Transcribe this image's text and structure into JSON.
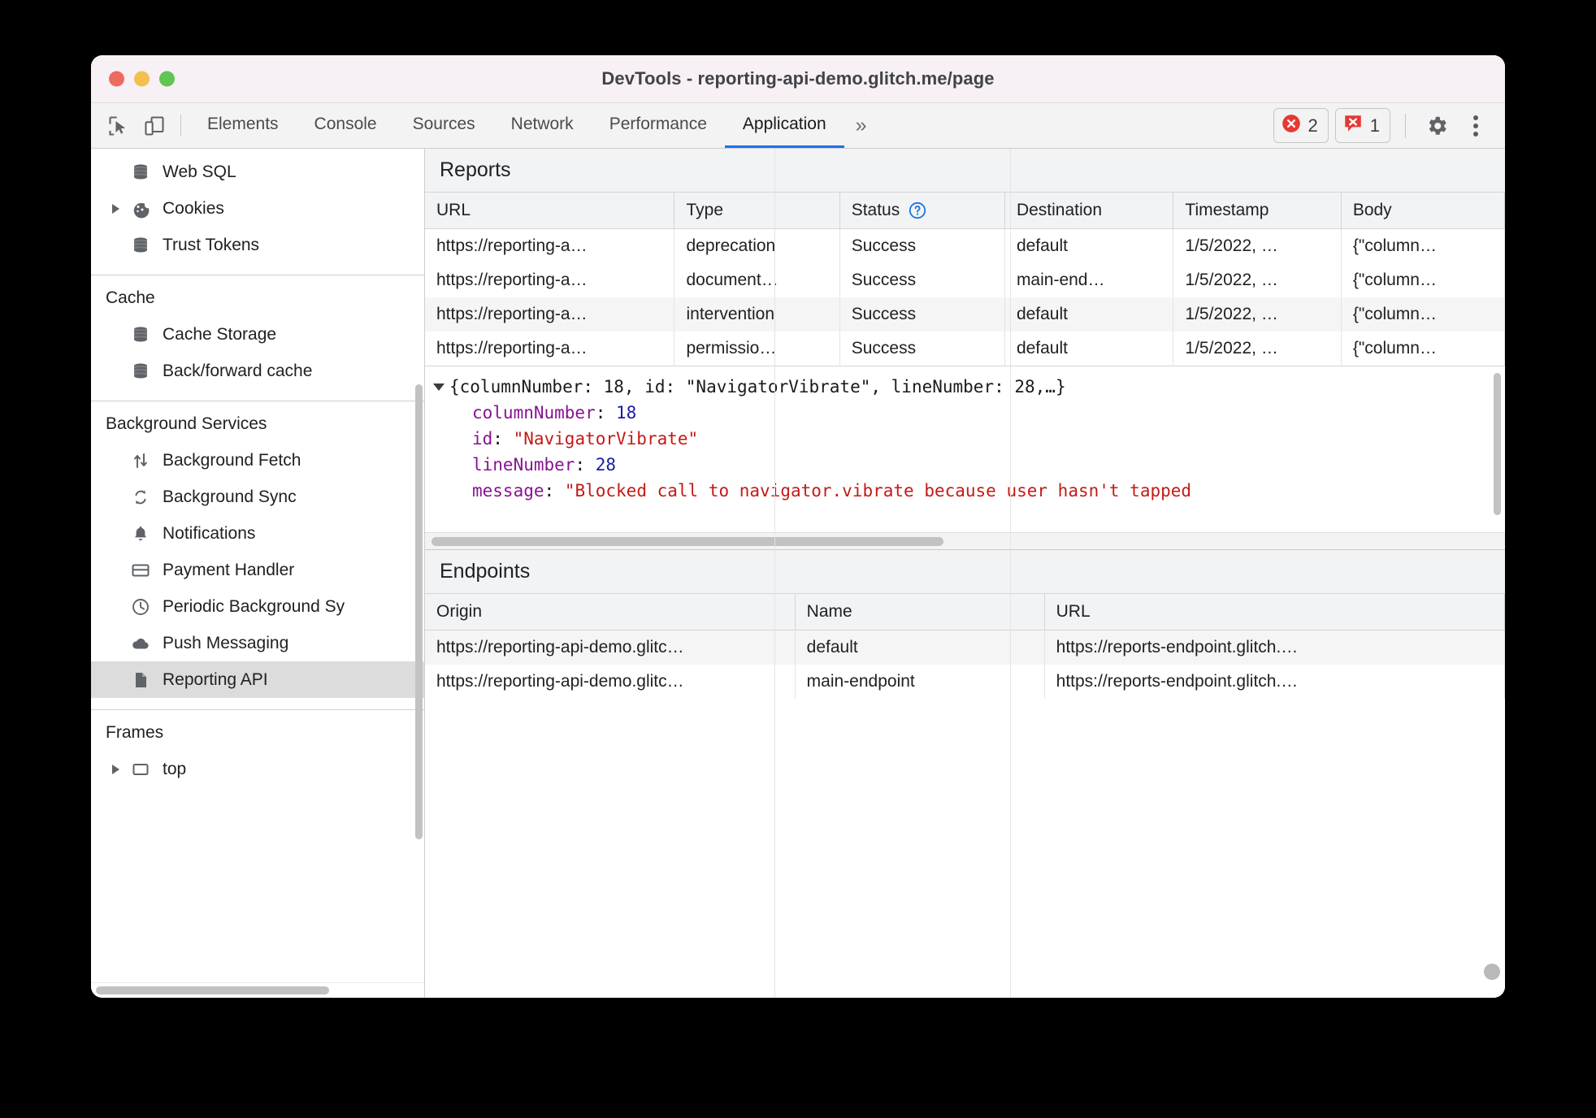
{
  "window": {
    "title": "DevTools - reporting-api-demo.glitch.me/page"
  },
  "toolbar": {
    "inspect_icon": "inspect-cursor-icon",
    "device_icon": "device-toolbar-icon",
    "tabs": [
      {
        "label": "Elements",
        "active": false
      },
      {
        "label": "Console",
        "active": false
      },
      {
        "label": "Sources",
        "active": false
      },
      {
        "label": "Network",
        "active": false
      },
      {
        "label": "Performance",
        "active": false
      },
      {
        "label": "Application",
        "active": true
      }
    ],
    "more_tabs": "»",
    "error_badge": {
      "count": "2",
      "icon": "error-circle-icon",
      "color": "#e53935"
    },
    "issue_badge": {
      "count": "1",
      "icon": "issue-speech-bubble-icon",
      "color": "#e53935"
    },
    "settings_icon": "gear-icon",
    "menu_icon": "kebab-menu-icon"
  },
  "sidebar": {
    "storage_items": [
      {
        "label": "Web SQL",
        "icon": "database-icon",
        "expandable": false
      },
      {
        "label": "Cookies",
        "icon": "cookie-icon",
        "expandable": true
      },
      {
        "label": "Trust Tokens",
        "icon": "database-icon",
        "expandable": false
      }
    ],
    "cache_title": "Cache",
    "cache_items": [
      {
        "label": "Cache Storage",
        "icon": "database-icon",
        "expandable": false
      },
      {
        "label": "Back/forward cache",
        "icon": "database-icon",
        "expandable": false
      }
    ],
    "background_title": "Background Services",
    "background_items": [
      {
        "label": "Background Fetch",
        "icon": "updown-arrows-icon",
        "expandable": false,
        "selected": false
      },
      {
        "label": "Background Sync",
        "icon": "sync-icon",
        "expandable": false,
        "selected": false
      },
      {
        "label": "Notifications",
        "icon": "bell-icon",
        "expandable": false,
        "selected": false
      },
      {
        "label": "Payment Handler",
        "icon": "credit-card-icon",
        "expandable": false,
        "selected": false
      },
      {
        "label": "Periodic Background Sy",
        "icon": "clock-icon",
        "expandable": false,
        "selected": false
      },
      {
        "label": "Push Messaging",
        "icon": "cloud-icon",
        "expandable": false,
        "selected": false
      },
      {
        "label": "Reporting API",
        "icon": "document-icon",
        "expandable": false,
        "selected": true
      }
    ],
    "frames_title": "Frames",
    "frames_items": [
      {
        "label": "top",
        "icon": "frame-icon",
        "expandable": true
      }
    ]
  },
  "reports": {
    "title": "Reports",
    "columns": [
      "URL",
      "Type",
      "Status",
      "Destination",
      "Timestamp",
      "Body"
    ],
    "status_help_icon": "help-question-icon",
    "rows": [
      {
        "url": "https://reporting-a…",
        "type": "deprecation",
        "status": "Success",
        "destination": "default",
        "timestamp": "1/5/2022, …",
        "body": "{\"column…"
      },
      {
        "url": "https://reporting-a…",
        "type": "document…",
        "status": "Success",
        "destination": "main-end…",
        "timestamp": "1/5/2022, …",
        "body": "{\"column…"
      },
      {
        "url": "https://reporting-a…",
        "type": "intervention",
        "status": "Success",
        "destination": "default",
        "timestamp": "1/5/2022, …",
        "body": "{\"column…"
      },
      {
        "url": "https://reporting-a…",
        "type": "permissio…",
        "status": "Success",
        "destination": "default",
        "timestamp": "1/5/2022, …",
        "body": "{\"column…"
      }
    ]
  },
  "report_body": {
    "summary_prefix": "{",
    "summary": "{columnNumber: 18, id: \"NavigatorVibrate\", lineNumber: 28,…}",
    "lines": [
      {
        "key": "columnNumber",
        "value": "18",
        "kind": "number"
      },
      {
        "key": "id",
        "value": "\"NavigatorVibrate\"",
        "kind": "string"
      },
      {
        "key": "lineNumber",
        "value": "28",
        "kind": "number"
      },
      {
        "key": "message",
        "value": "\"Blocked call to navigator.vibrate because user hasn't tapped",
        "kind": "string"
      }
    ]
  },
  "endpoints": {
    "title": "Endpoints",
    "columns": [
      "Origin",
      "Name",
      "URL"
    ],
    "rows": [
      {
        "origin": "https://reporting-api-demo.glitc…",
        "name": "default",
        "url": "https://reports-endpoint.glitch.…"
      },
      {
        "origin": "https://reporting-api-demo.glitc…",
        "name": "main-endpoint",
        "url": "https://reports-endpoint.glitch.…"
      }
    ]
  }
}
